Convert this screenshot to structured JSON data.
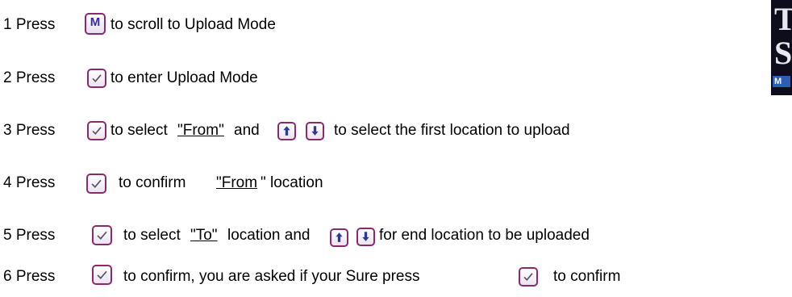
{
  "steps": [
    {
      "pre": "1 Press",
      "text": "to scroll to Upload Mode"
    },
    {
      "pre": "2 Press",
      "text": "to enter Upload Mode"
    },
    {
      "pre": "3 Press",
      "text1": "to select",
      "link": "\"From\"",
      "text2": "and",
      "text3": "to select the first location to upload"
    },
    {
      "pre": "4 Press",
      "text1": "to confirm",
      "link": "\"From",
      "text2": "\" location"
    },
    {
      "pre": "5 Press",
      "text1": "to select",
      "link": "\"To\"",
      "text2": "location and",
      "text3": "for end location to be uploaded"
    },
    {
      "pre": "6 Press",
      "text1": "to confirm, you are asked if your Sure press",
      "text2": "to confirm"
    }
  ],
  "keys": {
    "mode": "M"
  },
  "brand": {
    "letter1": "T",
    "letter2": "S",
    "badge": "M"
  },
  "icons": {
    "mode": "m-key-icon",
    "confirm": "check-key-icon",
    "up": "up-arrow-key-icon",
    "down": "down-arrow-key-icon"
  },
  "colors": {
    "key_border": "#8a2a6e",
    "arrow_fill": "#2a3a9a",
    "check_stroke": "#555566",
    "brand_bg": "#0d0d1c",
    "brand_badge": "#2e5db5"
  }
}
